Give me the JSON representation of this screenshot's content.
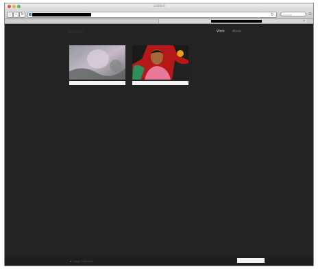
{
  "browser": {
    "window_title": "Untitled",
    "search_placeholder": "Google",
    "back_glyph": "‹",
    "forward_glyph": "›",
    "reload_glyph": "↻",
    "tab_close_glyph": "×"
  },
  "site": {
    "logo": "Portfolio",
    "nav": [
      {
        "label": "Work",
        "active": true
      },
      {
        "label": "About",
        "active": false
      }
    ],
    "projects": [
      {
        "caption": "",
        "image": "pale-face-collage"
      },
      {
        "caption": "",
        "image": "portrait-red-pattern"
      }
    ],
    "footer": {
      "credit": "Cargo Collective"
    }
  },
  "colors": {
    "page_bg": "#232323",
    "nav_active": "#d0d0d0",
    "nav_inactive": "#777777"
  }
}
